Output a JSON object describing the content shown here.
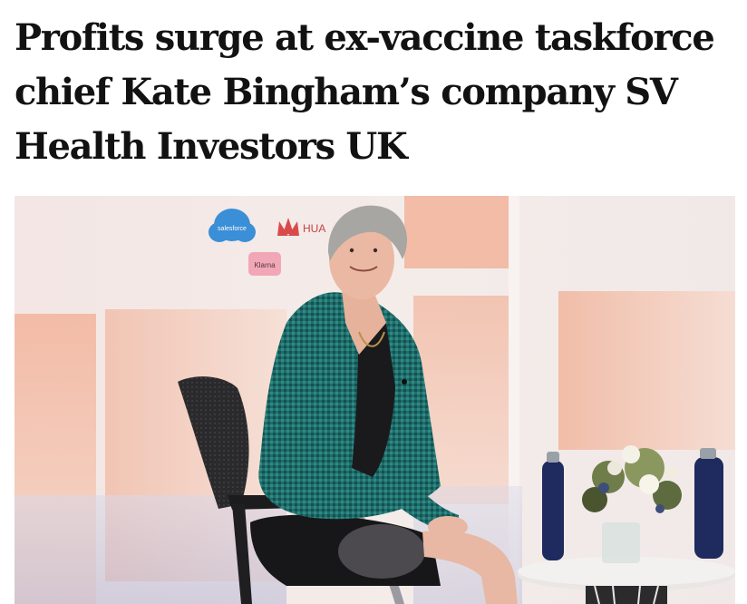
{
  "article": {
    "headline_lines": [
      "Profits surge at ex-vaccine taskforce",
      "chief Kate Bingham’s company SV",
      "Health Investors UK"
    ]
  },
  "photo": {
    "backdrop_logos": [
      "salesforce",
      "HUA",
      "Klarna"
    ]
  }
}
